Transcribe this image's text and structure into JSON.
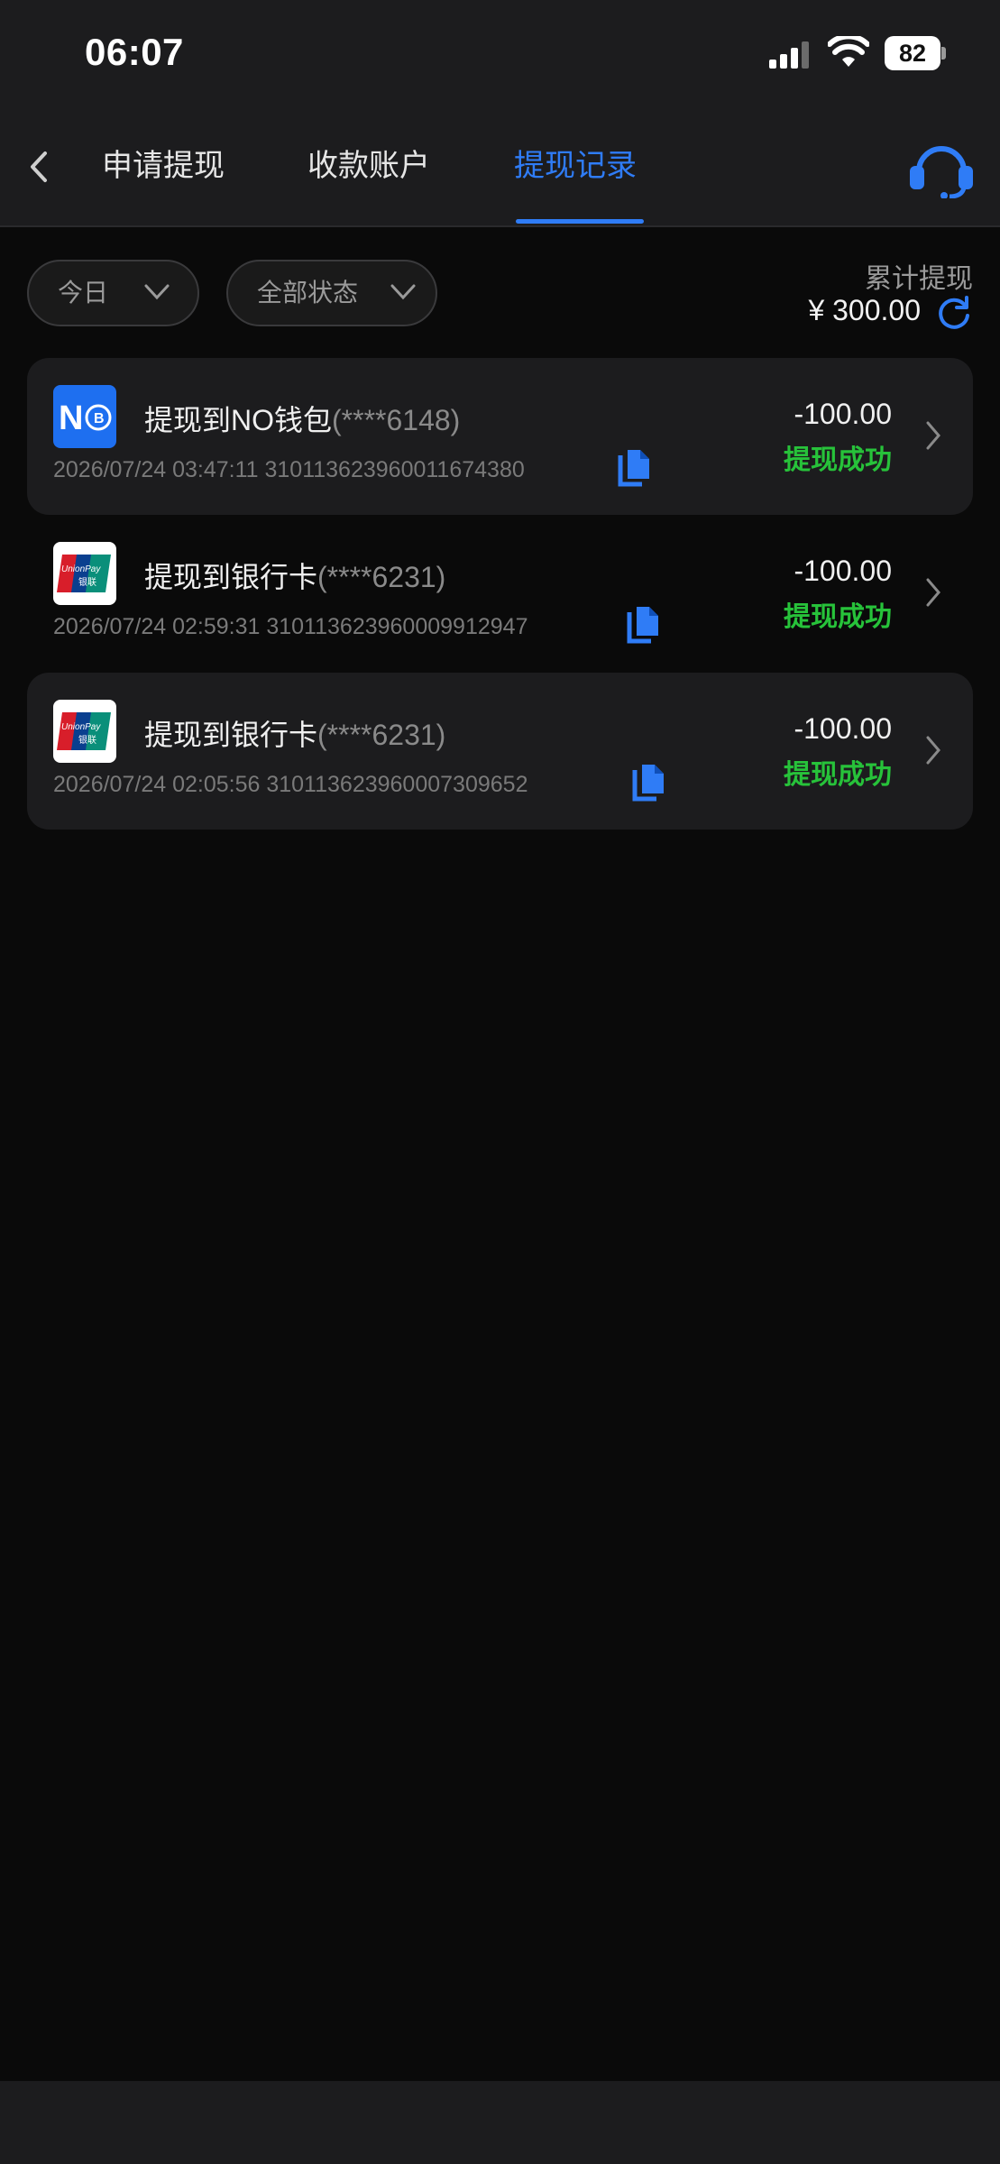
{
  "status_bar": {
    "time": "06:07",
    "battery": "82"
  },
  "nav": {
    "tabs": [
      {
        "label": "申请提现",
        "active": false
      },
      {
        "label": "收款账户",
        "active": false
      },
      {
        "label": "提现记录",
        "active": true
      }
    ]
  },
  "filters": {
    "date": "今日",
    "status": "全部状态"
  },
  "summary": {
    "label": "累计提现",
    "amount": "¥ 300.00"
  },
  "records": [
    {
      "logo": "no-wallet-logo",
      "title": "提现到NO钱包",
      "account_mask": "(****6148)",
      "datetime": "2026/07/24 03:47:11",
      "order_id": "3101136239600116743​80",
      "amount": "-100.00",
      "status": "提现成功"
    },
    {
      "logo": "unionpay-logo",
      "title": "提现到银行卡",
      "account_mask": "(****6231)",
      "datetime": "2026/07/24 02:59:31",
      "order_id": "310113623960009912947",
      "amount": "-100.00",
      "status": "提现成功"
    },
    {
      "logo": "unionpay-logo",
      "title": "提现到银行卡",
      "account_mask": "(****6231)",
      "datetime": "2026/07/24 02:05:56",
      "order_id": "310113623960007309652",
      "amount": "-100.00",
      "status": "提现成功"
    }
  ],
  "colors": {
    "accent": "#2f7cf6",
    "success": "#27c23a",
    "background": "#0a0a0a",
    "card": "#1c1c1e"
  }
}
